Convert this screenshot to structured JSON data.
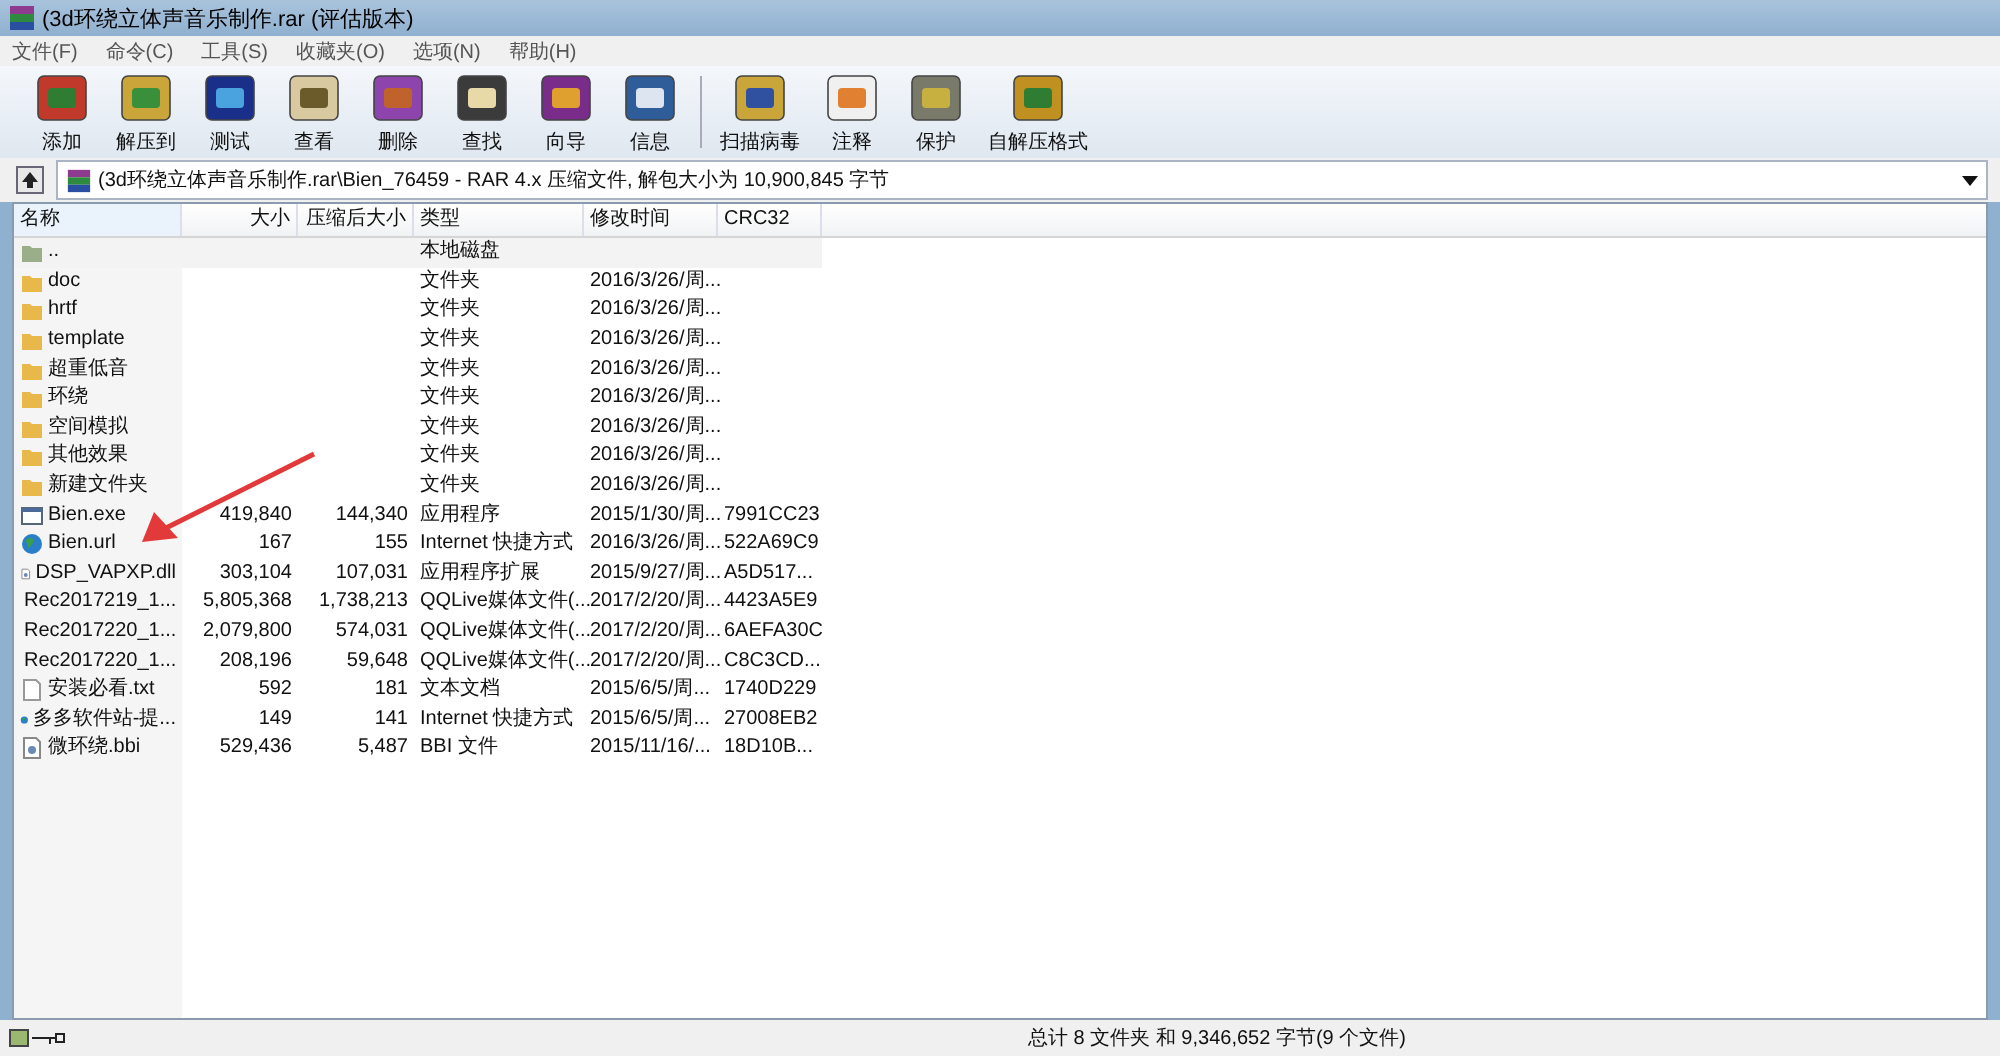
{
  "window": {
    "title": "(3d环绕立体声音乐制作.rar (评估版本)"
  },
  "menu": [
    "文件(F)",
    "命令(C)",
    "工具(S)",
    "收藏夹(O)",
    "选项(N)",
    "帮助(H)"
  ],
  "toolbar": [
    {
      "label": "添加",
      "kind": "add"
    },
    {
      "label": "解压到",
      "kind": "extract"
    },
    {
      "label": "测试",
      "kind": "test"
    },
    {
      "label": "查看",
      "kind": "view"
    },
    {
      "label": "删除",
      "kind": "delete"
    },
    {
      "label": "查找",
      "kind": "find"
    },
    {
      "label": "向导",
      "kind": "wizard"
    },
    {
      "label": "信息",
      "kind": "info"
    },
    {
      "label": "扫描病毒",
      "kind": "scan",
      "separator": true
    },
    {
      "label": "注释",
      "kind": "comment"
    },
    {
      "label": "保护",
      "kind": "protect"
    },
    {
      "label": "自解压格式",
      "kind": "sfx"
    }
  ],
  "path": "(3d环绕立体声音乐制作.rar\\Bien_76459 - RAR 4.x 压缩文件, 解包大小为 10,900,845 字节",
  "table": {
    "columns": [
      "名称",
      "大小",
      "压缩后大小",
      "类型",
      "修改时间",
      "CRC32"
    ],
    "rows": [
      {
        "kind": "parent",
        "name": "..",
        "type": "本地磁盘"
      },
      {
        "kind": "folder",
        "name": "doc",
        "type": "文件夹",
        "modified": "2016/3/26/周..."
      },
      {
        "kind": "folder",
        "name": "hrtf",
        "type": "文件夹",
        "modified": "2016/3/26/周..."
      },
      {
        "kind": "folder",
        "name": "template",
        "type": "文件夹",
        "modified": "2016/3/26/周..."
      },
      {
        "kind": "folder",
        "name": "超重低音",
        "type": "文件夹",
        "modified": "2016/3/26/周..."
      },
      {
        "kind": "folder",
        "name": "环绕",
        "type": "文件夹",
        "modified": "2016/3/26/周..."
      },
      {
        "kind": "folder",
        "name": "空间模拟",
        "type": "文件夹",
        "modified": "2016/3/26/周..."
      },
      {
        "kind": "folder",
        "name": "其他效果",
        "type": "文件夹",
        "modified": "2016/3/26/周..."
      },
      {
        "kind": "folder",
        "name": "新建文件夹",
        "type": "文件夹",
        "modified": "2016/3/26/周..."
      },
      {
        "kind": "exe",
        "name": "Bien.exe",
        "size": "419,840",
        "packed": "144,340",
        "type": "应用程序",
        "modified": "2015/1/30/周...",
        "crc": "7991CC23"
      },
      {
        "kind": "url",
        "name": "Bien.url",
        "size": "167",
        "packed": "155",
        "type": "Internet 快捷方式",
        "modified": "2016/3/26/周...",
        "crc": "522A69C9"
      },
      {
        "kind": "dll",
        "name": "DSP_VAPXP.dll",
        "size": "303,104",
        "packed": "107,031",
        "type": "应用程序扩展",
        "modified": "2015/9/27/周...",
        "crc": "A5D517..."
      },
      {
        "kind": "file",
        "name": "Rec2017219_1...",
        "size": "5,805,368",
        "packed": "1,738,213",
        "type": "QQLive媒体文件(...",
        "modified": "2017/2/20/周...",
        "crc": "4423A5E9"
      },
      {
        "kind": "file",
        "name": "Rec2017220_1...",
        "size": "2,079,800",
        "packed": "574,031",
        "type": "QQLive媒体文件(...",
        "modified": "2017/2/20/周...",
        "crc": "6AEFA30C"
      },
      {
        "kind": "file",
        "name": "Rec2017220_1...",
        "size": "208,196",
        "packed": "59,648",
        "type": "QQLive媒体文件(...",
        "modified": "2017/2/20/周...",
        "crc": "C8C3CD..."
      },
      {
        "kind": "file",
        "name": "安装必看.txt",
        "size": "592",
        "packed": "181",
        "type": "文本文档",
        "modified": "2015/6/5/周...",
        "crc": "1740D229"
      },
      {
        "kind": "url",
        "name": "多多软件站-提...",
        "size": "149",
        "packed": "141",
        "type": "Internet 快捷方式",
        "modified": "2015/6/5/周...",
        "crc": "27008EB2"
      },
      {
        "kind": "dll",
        "name": "微环绕.bbi",
        "size": "529,436",
        "packed": "5,487",
        "type": "BBI 文件",
        "modified": "2015/11/16/...",
        "crc": "18D10B..."
      }
    ]
  },
  "status_bar": {
    "summary": "总计 8 文件夹 和 9,346,652 字节(9 个文件)"
  }
}
